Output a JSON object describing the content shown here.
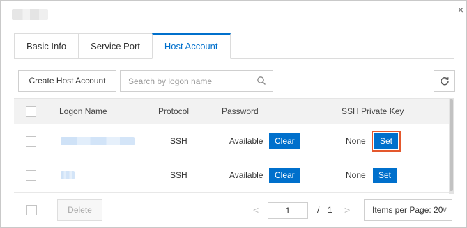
{
  "dialog": {
    "close_glyph": "×"
  },
  "tabs": [
    {
      "label": "Basic Info",
      "active": false
    },
    {
      "label": "Service Port",
      "active": false
    },
    {
      "label": "Host Account",
      "active": true
    }
  ],
  "toolbar": {
    "create_label": "Create Host Account",
    "search_placeholder": "Search by logon name",
    "search_value": "",
    "refresh_icon": "refresh-icon"
  },
  "table": {
    "columns": [
      "Logon Name",
      "Protocol",
      "Password",
      "SSH Private Key"
    ],
    "rows": [
      {
        "protocol": "SSH",
        "password_status": "Available",
        "password_action": "Clear",
        "ssh_status": "None",
        "ssh_action": "Set",
        "highlighted": true
      },
      {
        "protocol": "SSH",
        "password_status": "Available",
        "password_action": "Clear",
        "ssh_status": "None",
        "ssh_action": "Set",
        "highlighted": false
      }
    ]
  },
  "footer": {
    "delete_label": "Delete",
    "prev_glyph": "<",
    "next_glyph": ">",
    "page_current": "1",
    "page_sep": "/",
    "page_total": "1",
    "per_page_label": "Items per Page: 20",
    "per_page_chevron": "∨"
  },
  "colors": {
    "accent": "#0070cc",
    "highlight": "#e4582d"
  }
}
